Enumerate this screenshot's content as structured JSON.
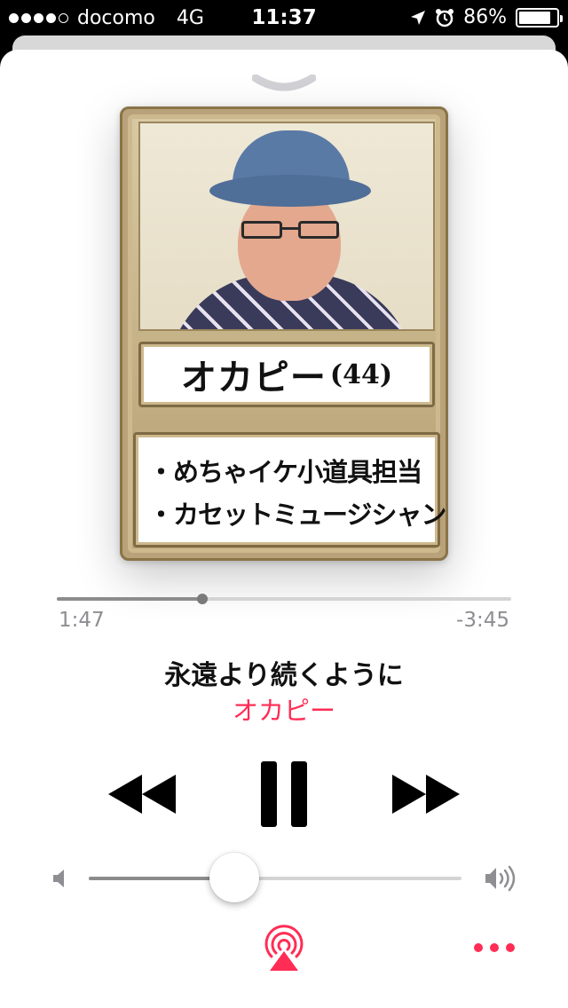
{
  "status_bar": {
    "signal_full": 4,
    "signal_total": 5,
    "carrier": "docomo",
    "network": "4G",
    "time": "11:37",
    "battery_percent": "86%",
    "battery_level": 0.86
  },
  "artwork": {
    "name": "オカピー",
    "age": "(44)",
    "lines": [
      "・めちゃイケ小道具担当",
      "・カセットミュージシャン"
    ]
  },
  "player": {
    "elapsed": "1:47",
    "remaining": "-3:45",
    "progress": 0.32,
    "song_title": "永遠より続くように",
    "artist": "オカピー",
    "volume": 0.39
  },
  "colors": {
    "accent": "#ff2d55",
    "track": "#d4d4d4",
    "track_fill": "#8c8c8c"
  },
  "icons": {
    "dismiss": "chevron-down-icon",
    "rewind": "rewind-icon",
    "pause": "pause-icon",
    "forward": "fast-forward-icon",
    "volume_min": "speaker-icon",
    "volume_max": "speaker-loud-icon",
    "airplay": "airplay-icon",
    "more": "more-icon"
  }
}
